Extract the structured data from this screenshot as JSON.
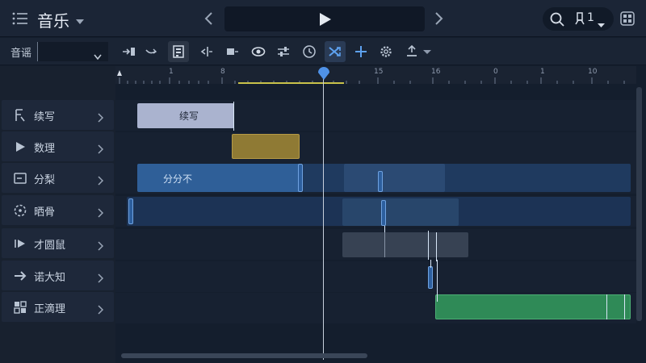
{
  "header": {
    "title": "音乐",
    "menu_icon": "list-icon",
    "title_dropdown_icon": "chevron-down-icon",
    "prev_icon": "chevron-left-icon",
    "next_icon": "chevron-right-icon",
    "play_icon": "play-icon",
    "search_icon": "search-icon",
    "user_icon": "user-icon",
    "user_count": "1",
    "layout_icon": "grid-icon"
  },
  "toolbar": {
    "track_label": "音谣",
    "track_value": "",
    "tools": [
      {
        "icon": "snap-right-icon",
        "state": "normal"
      },
      {
        "icon": "curve-icon",
        "state": "normal"
      },
      {
        "icon": "clipboard-icon",
        "state": "gray"
      },
      {
        "icon": "split-left-icon",
        "state": "normal"
      },
      {
        "icon": "flag-icon",
        "state": "normal"
      },
      {
        "icon": "eye-icon",
        "state": "normal"
      },
      {
        "icon": "sliders-icon",
        "state": "normal"
      },
      {
        "icon": "clock-icon",
        "state": "normal"
      },
      {
        "icon": "shuffle-icon",
        "state": "active"
      },
      {
        "icon": "plus-icon",
        "state": "normal"
      },
      {
        "icon": "settings-icon",
        "state": "normal"
      },
      {
        "icon": "export-icon",
        "state": "normal"
      }
    ]
  },
  "tracks": [
    {
      "label": "续写",
      "icon": "text-style-icon"
    },
    {
      "label": "数理",
      "icon": "play-icon"
    },
    {
      "label": "分梨",
      "icon": "panel-icon"
    },
    {
      "label": "晒骨",
      "icon": "loop-icon"
    },
    {
      "label": "才圆鼠",
      "icon": "step-forward-icon"
    },
    {
      "label": "诺大知",
      "icon": "arrow-right-icon"
    },
    {
      "label": "正滴理",
      "icon": "dashboard-icon"
    }
  ],
  "ruler": {
    "labels": [
      "1",
      "8",
      "15",
      "16",
      "0",
      "1",
      "10"
    ]
  },
  "clips": [
    {
      "track": 0,
      "label": "续写",
      "color": "#aab3cf"
    },
    {
      "track": 1,
      "label": "",
      "color": "#8f7a34"
    },
    {
      "track": 2,
      "label": "分分不",
      "color": "#2f5f98"
    },
    {
      "track": 6,
      "label": "",
      "color": "#2f8a57"
    }
  ],
  "colors": {
    "background": "#141e2d",
    "accent": "#4f92e8",
    "playhead": "#c7d0dc"
  }
}
